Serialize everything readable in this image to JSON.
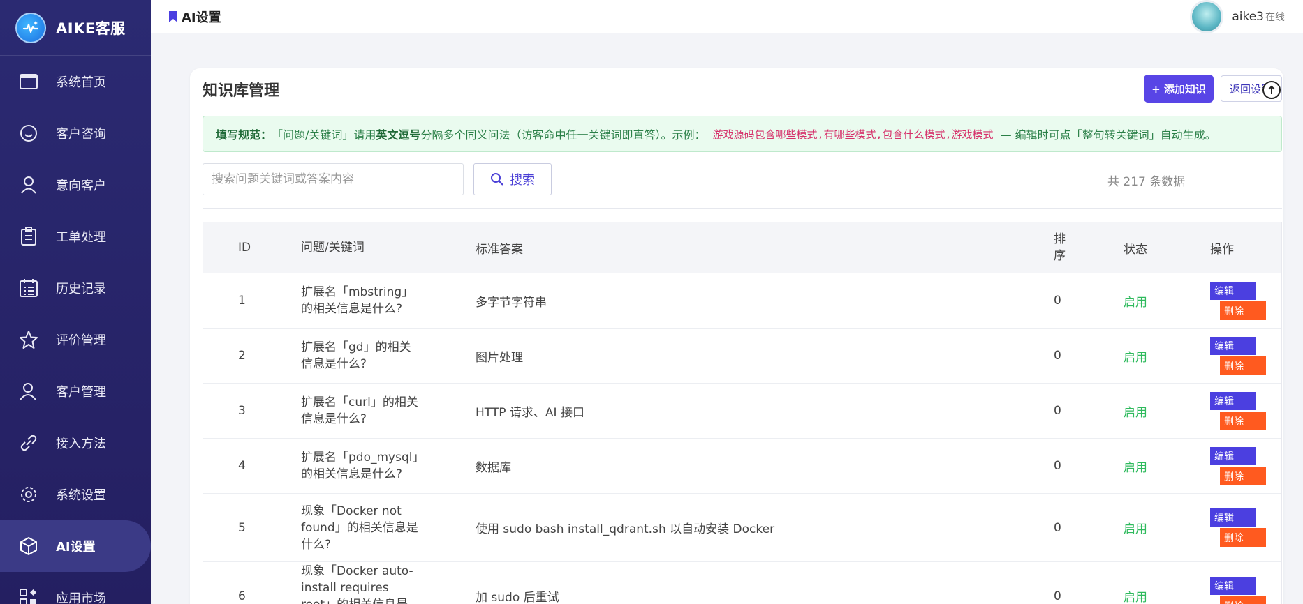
{
  "brand": {
    "title": "AIKE客服"
  },
  "sidebar": {
    "items": [
      {
        "label": "系统首页",
        "icon": "browser-window-icon"
      },
      {
        "label": "客户咨询",
        "icon": "smile-face-icon"
      },
      {
        "label": "意向客户",
        "icon": "user-icon"
      },
      {
        "label": "工单处理",
        "icon": "clipboard-icon"
      },
      {
        "label": "历史记录",
        "icon": "calendar-list-icon"
      },
      {
        "label": "评价管理",
        "icon": "star-icon"
      },
      {
        "label": "客户管理",
        "icon": "users-icon"
      },
      {
        "label": "接入方法",
        "icon": "link-icon"
      },
      {
        "label": "系统设置",
        "icon": "gear-icon"
      },
      {
        "label": "AI设置",
        "icon": "cube-icon",
        "active": true
      },
      {
        "label": "应用市场",
        "icon": "apps-grid-icon"
      }
    ]
  },
  "header": {
    "title": "AI设置",
    "user_name": "aike3",
    "user_status": "在线"
  },
  "card": {
    "title": "知识库管理",
    "add_label": "+ 添加知识",
    "back_label": "返回设置"
  },
  "notice": {
    "lead": "填写规范：",
    "part1": "「问题/关键词」请用",
    "bold": "英文逗号",
    "part2": "分隔多个同义问法（访客命中任一关键词即直答）。示例：",
    "example": "游戏源码包含哪些模式,有哪些模式,包含什么模式,游戏模式",
    "part3": "— 编辑时可点「整句转关键词」自动生成。"
  },
  "search": {
    "placeholder": "搜索问题关键词或答案内容",
    "button_label": "搜索"
  },
  "total_text": "共 217 条数据",
  "table": {
    "headers": {
      "id": "ID",
      "question": "问题/关键词",
      "answer": "标准答案",
      "sort": "排序",
      "status": "状态",
      "ops": "操作"
    },
    "edit_label": "编辑",
    "delete_label": "删除",
    "rows": [
      {
        "id": "1",
        "question": "扩展名「mbstring」的相关信息是什么?",
        "answer": "多字节字符串",
        "sort": "0",
        "status": "启用"
      },
      {
        "id": "2",
        "question": "扩展名「gd」的相关信息是什么?",
        "answer": "图片处理",
        "sort": "0",
        "status": "启用"
      },
      {
        "id": "3",
        "question": "扩展名「curl」的相关信息是什么?",
        "answer": "HTTP 请求、AI 接口",
        "sort": "0",
        "status": "启用"
      },
      {
        "id": "4",
        "question": "扩展名「pdo_mysql」的相关信息是什么?",
        "answer": "数据库",
        "sort": "0",
        "status": "启用"
      },
      {
        "id": "5",
        "question": "现象「Docker not found」的相关信息是什么?",
        "answer": "使用 sudo bash install_qdrant.sh 以自动安装 Docker",
        "sort": "0",
        "status": "启用"
      },
      {
        "id": "6",
        "question": "现象「Docker auto-install requires root」的相关信息是什么?",
        "answer": "加 sudo 后重试",
        "sort": "0",
        "status": "启用"
      }
    ]
  }
}
